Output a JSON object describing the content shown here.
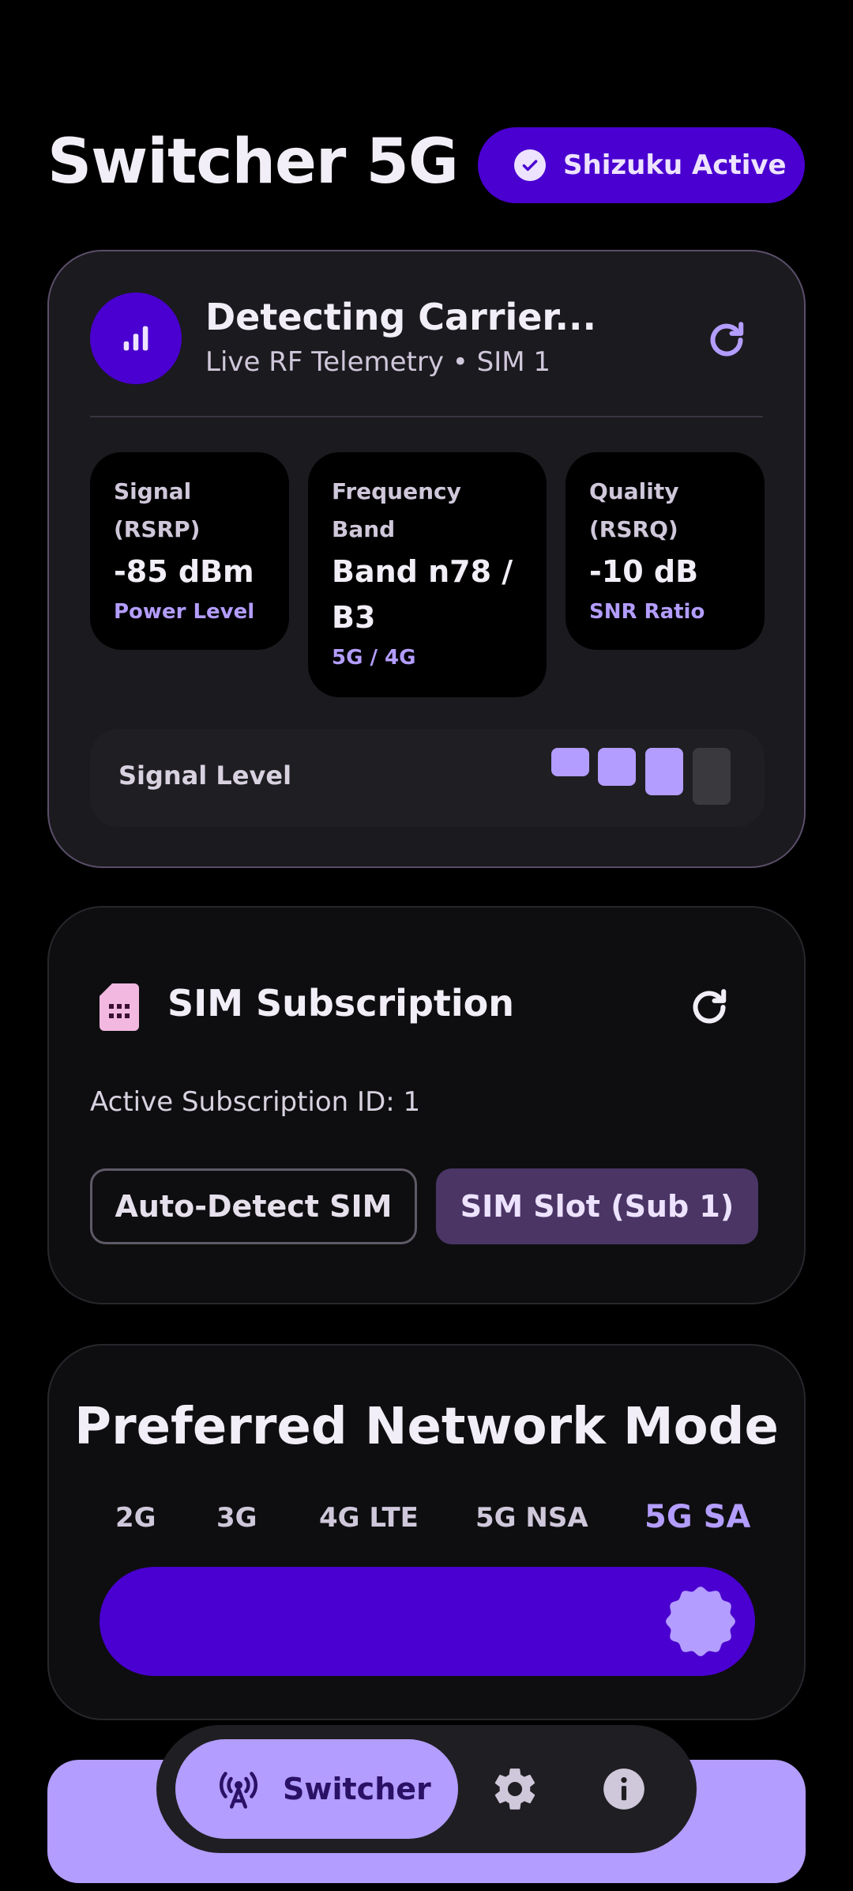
{
  "header": {
    "title": "Switcher 5G",
    "status_badge": "Shizuku Active"
  },
  "telemetry": {
    "carrier": "Detecting Carrier...",
    "subtitle": "Live RF Telemetry • SIM 1",
    "metrics": [
      {
        "label": "Signal (RSRP)",
        "value": "-85 dBm",
        "sub": "Power Level"
      },
      {
        "label": "Frequency Band",
        "value": "Band n78 / B3",
        "sub": "5G / 4G"
      },
      {
        "label": "Quality (RSRQ)",
        "value": "-10 dB",
        "sub": "SNR Ratio"
      }
    ],
    "signal_level_label": "Signal Level",
    "signal_level": {
      "filled": 3,
      "total": 4
    }
  },
  "sim": {
    "title": "SIM Subscription",
    "active_id": "Active Subscription ID: 1",
    "auto_detect": "Auto-Detect SIM",
    "slot": "SIM Slot (Sub 1)"
  },
  "mode": {
    "title": "Preferred Network Mode",
    "options": [
      "2G",
      "3G",
      "4G LTE",
      "5G NSA",
      "5G SA"
    ],
    "selected": "5G SA",
    "selected_index": 4
  },
  "nav": {
    "switcher": "Switcher"
  },
  "colors": {
    "accent": "#4A00D0",
    "accent_light": "#B39DFF",
    "background": "#000000",
    "card": "#1B1A1E"
  }
}
